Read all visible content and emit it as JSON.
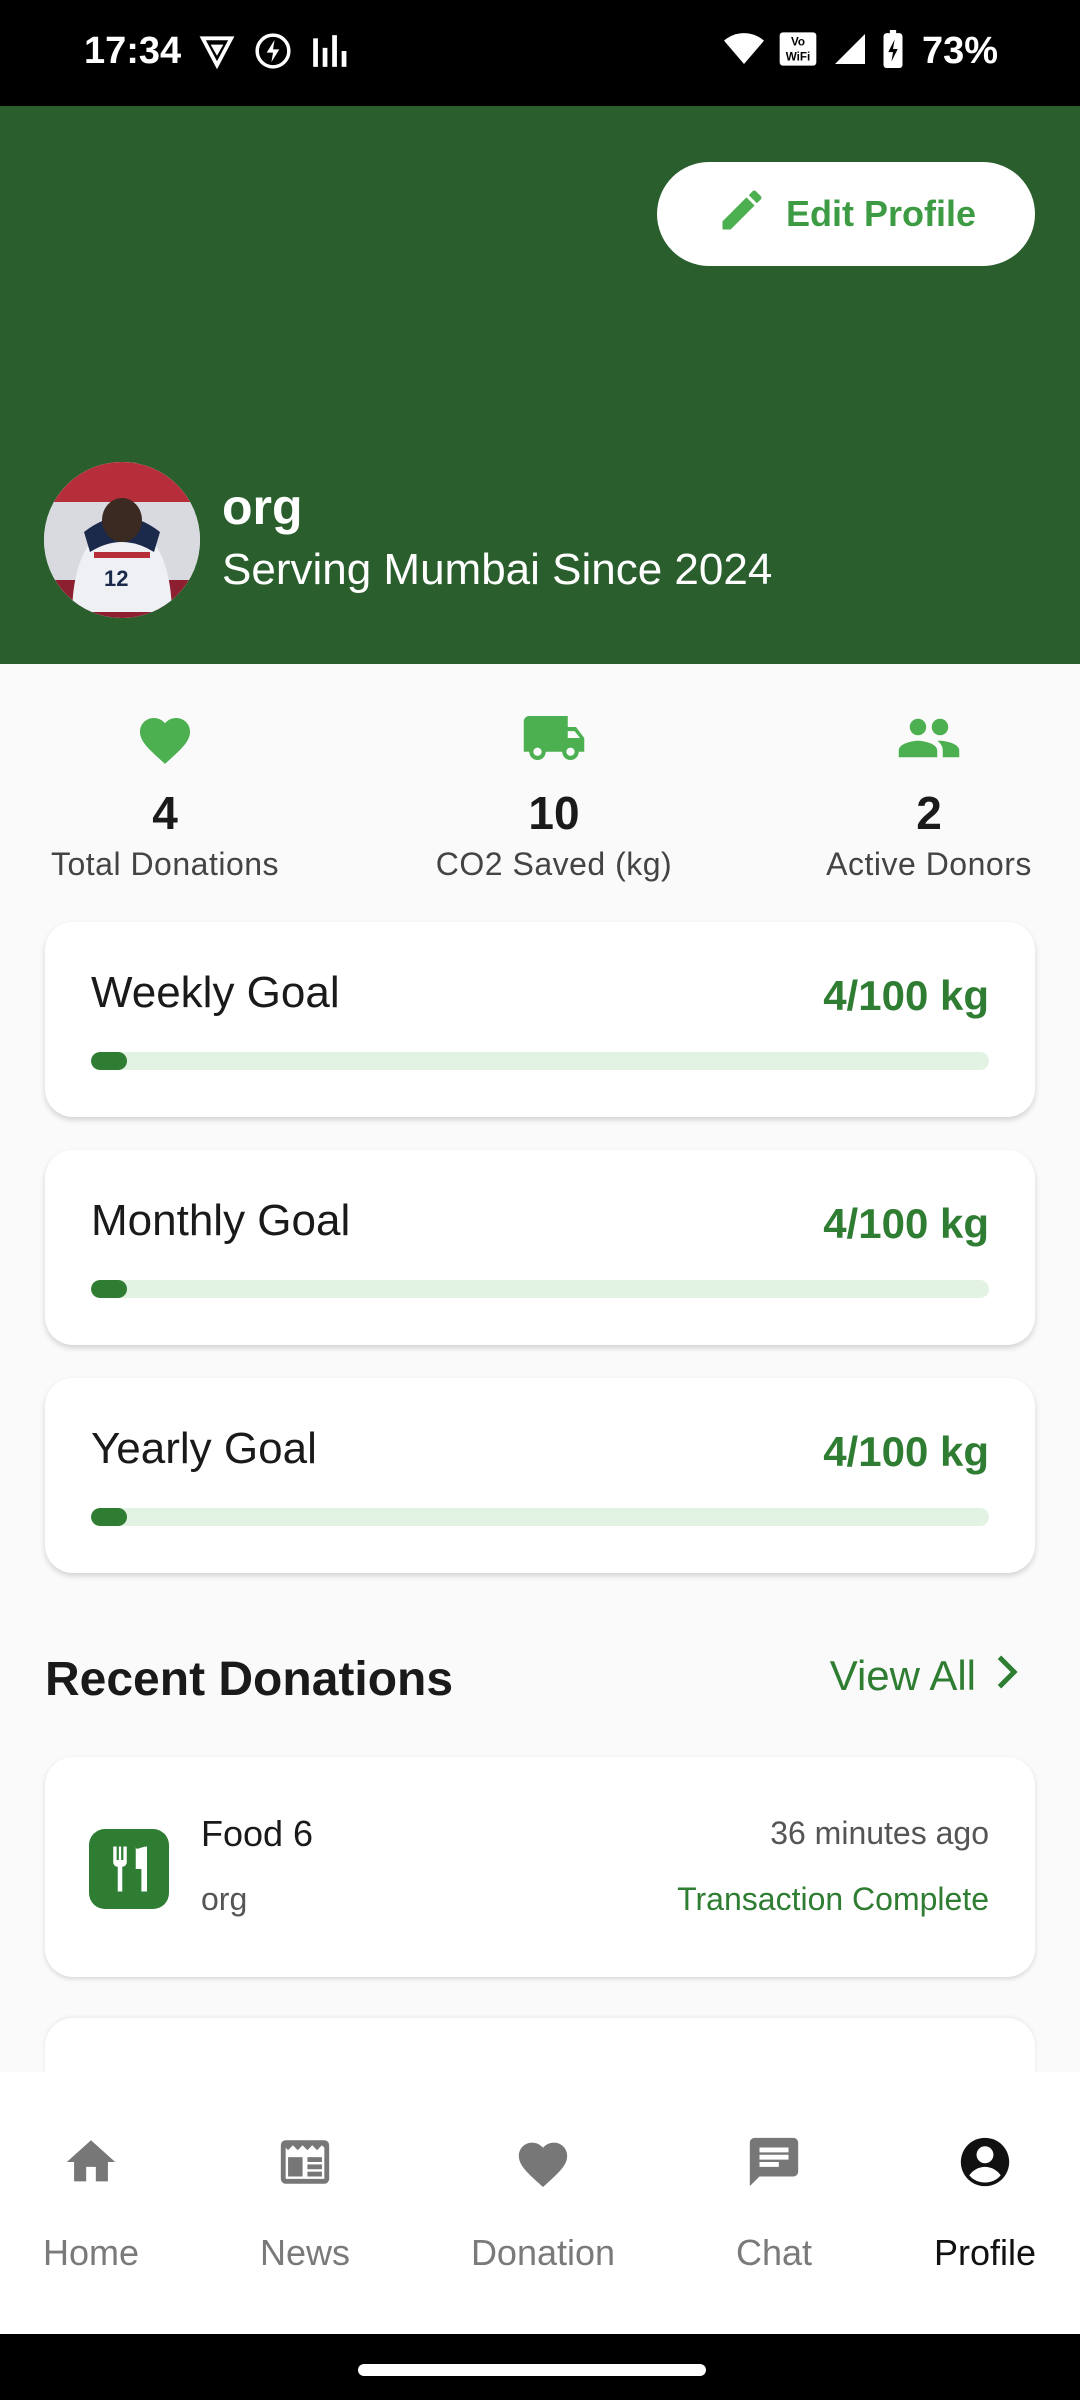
{
  "status_bar": {
    "time": "17:34",
    "battery": "73%",
    "icons": [
      "vpn-icon",
      "bolt-icon",
      "signal-bars-icon",
      "wifi-icon",
      "vowifi-icon",
      "cell-signal-icon",
      "battery-charging-icon"
    ]
  },
  "header": {
    "edit_label": "Edit Profile",
    "name": "org",
    "subtitle": "Serving Mumbai Since 2024",
    "bg_color": "#2a5e2d"
  },
  "stats": [
    {
      "icon": "heart-icon",
      "value": "4",
      "label": "Total Donations"
    },
    {
      "icon": "truck-icon",
      "value": "10",
      "label": "CO2 Saved (kg)"
    },
    {
      "icon": "people-icon",
      "value": "2",
      "label": "Active Donors"
    }
  ],
  "goals": [
    {
      "title": "Weekly Goal",
      "amount": "4/100 kg",
      "progress": 0.04
    },
    {
      "title": "Monthly Goal",
      "amount": "4/100 kg",
      "progress": 0.04
    },
    {
      "title": "Yearly Goal",
      "amount": "4/100 kg",
      "progress": 0.04
    }
  ],
  "recent": {
    "title": "Recent Donations",
    "view_all": "View All",
    "items": [
      {
        "name": "Food 6",
        "org": "org",
        "time": "36 minutes ago",
        "status": "Transaction Complete",
        "icon": "utensils-icon"
      }
    ]
  },
  "nav": [
    {
      "label": "Home",
      "icon": "home-icon",
      "active": false
    },
    {
      "label": "News",
      "icon": "news-icon",
      "active": false
    },
    {
      "label": "Donation",
      "icon": "heart-icon",
      "active": false
    },
    {
      "label": "Chat",
      "icon": "chat-icon",
      "active": false
    },
    {
      "label": "Profile",
      "icon": "account-circle-icon",
      "active": true
    }
  ],
  "colors": {
    "accent": "#2e7d32",
    "accent_light": "#4caf50",
    "track": "#e3f3e3"
  }
}
